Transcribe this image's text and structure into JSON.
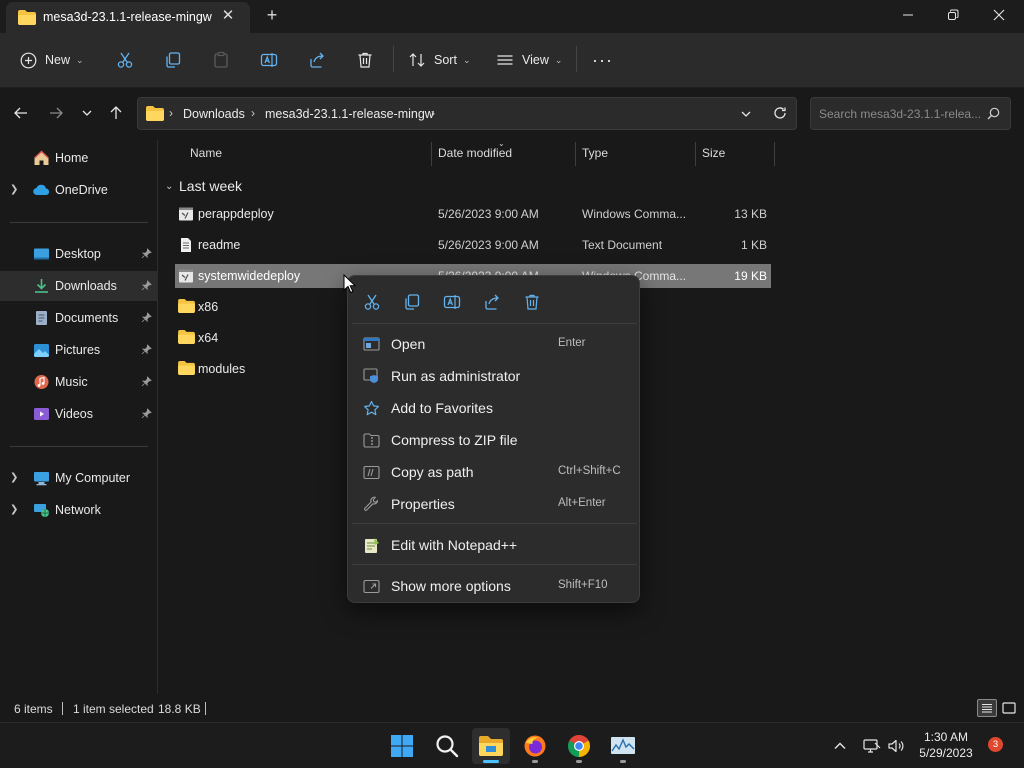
{
  "window": {
    "tab_title": "mesa3d-23.1.1-release-mingw",
    "tab_close": "✕",
    "new_tab": "+"
  },
  "toolbar": {
    "new_label": "New",
    "sort_label": "Sort",
    "view_label": "View",
    "more": "···"
  },
  "address": {
    "crumbs": [
      "Downloads",
      "mesa3d-23.1.1-release-mingw"
    ],
    "chevron": "›"
  },
  "search": {
    "placeholder": "Search mesa3d-23.1.1-relea..."
  },
  "sidebar": {
    "items": [
      {
        "label": "Home"
      },
      {
        "label": "OneDrive"
      },
      {
        "label": "Desktop"
      },
      {
        "label": "Downloads"
      },
      {
        "label": "Documents"
      },
      {
        "label": "Pictures"
      },
      {
        "label": "Music"
      },
      {
        "label": "Videos"
      },
      {
        "label": "My Computer"
      },
      {
        "label": "Network"
      }
    ]
  },
  "columns": {
    "name": "Name",
    "date": "Date modified",
    "type": "Type",
    "size": "Size"
  },
  "group": {
    "title": "Last week"
  },
  "files": [
    {
      "name": "perappdeploy",
      "date": "5/26/2023 9:00 AM",
      "type": "Windows Comma...",
      "size": "13 KB"
    },
    {
      "name": "readme",
      "date": "5/26/2023 9:00 AM",
      "type": "Text Document",
      "size": "1 KB"
    },
    {
      "name": "systemwidedeploy",
      "date": "5/26/2023 9:00 AM",
      "type": "Windows Comma...",
      "size": "19 KB"
    },
    {
      "name": "x86",
      "date": "",
      "type": "",
      "size": ""
    },
    {
      "name": "x64",
      "date": "",
      "type": "",
      "size": ""
    },
    {
      "name": "modules",
      "date": "",
      "type": "",
      "size": ""
    }
  ],
  "context_menu": {
    "items": [
      {
        "label": "Open",
        "shortcut": "Enter"
      },
      {
        "label": "Run as administrator",
        "shortcut": ""
      },
      {
        "label": "Add to Favorites",
        "shortcut": ""
      },
      {
        "label": "Compress to ZIP file",
        "shortcut": ""
      },
      {
        "label": "Copy as path",
        "shortcut": "Ctrl+Shift+C"
      },
      {
        "label": "Properties",
        "shortcut": "Alt+Enter"
      },
      {
        "label": "Edit with Notepad++",
        "shortcut": ""
      },
      {
        "label": "Show more options",
        "shortcut": "Shift+F10"
      }
    ]
  },
  "status": {
    "item_count": "6 items",
    "selection": "1 item selected",
    "selection_size": "18.8 KB"
  },
  "taskbar": {
    "time": "1:30 AM",
    "date": "5/29/2023",
    "notifications": "3"
  },
  "colors": {
    "folder": "#f5c342",
    "accent": "#4cc2ff",
    "selection_row": "#777777",
    "badge": "#e0482d"
  }
}
